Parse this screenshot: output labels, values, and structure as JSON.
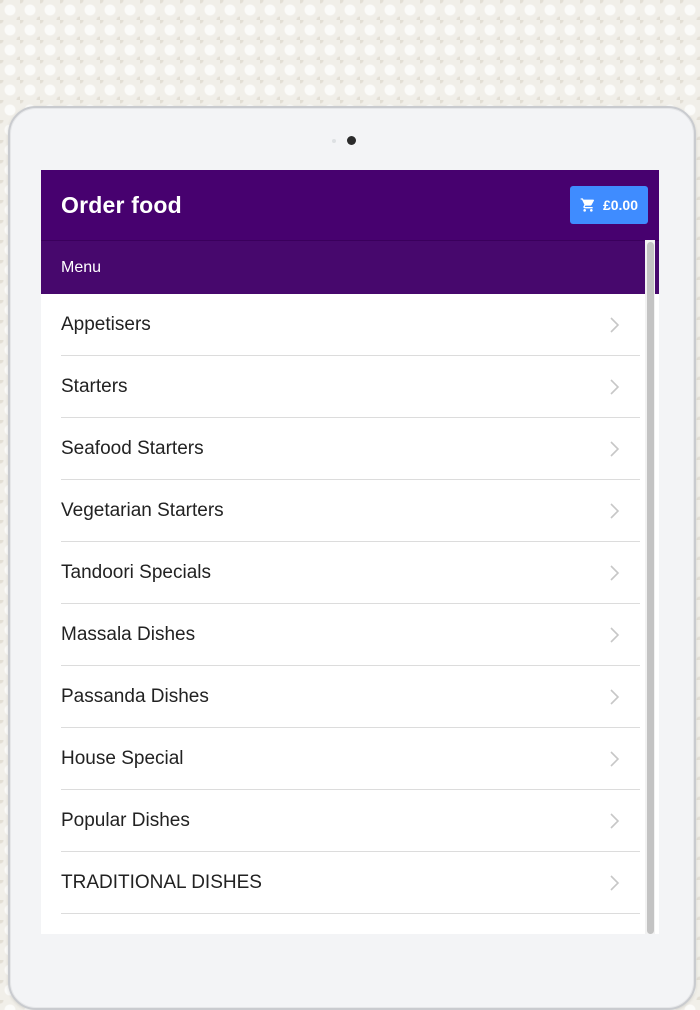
{
  "header": {
    "title": "Order food",
    "cart_total": "£0.00"
  },
  "subheader": {
    "label": "Menu"
  },
  "menu": {
    "items": [
      {
        "label": "Appetisers"
      },
      {
        "label": "Starters"
      },
      {
        "label": "Seafood Starters"
      },
      {
        "label": "Vegetarian Starters"
      },
      {
        "label": "Tandoori Specials"
      },
      {
        "label": "Massala Dishes"
      },
      {
        "label": "Passanda Dishes"
      },
      {
        "label": "House Special"
      },
      {
        "label": "Popular Dishes"
      },
      {
        "label": "TRADITIONAL DISHES"
      },
      {
        "label": ""
      }
    ]
  },
  "icons": {
    "cart": "cart-icon",
    "chevron": "chevron-right-icon"
  },
  "colors": {
    "appbar": "#47016f",
    "subheader": "#47086d",
    "cart_button": "#3f8cff",
    "chevron": "#c7c7c7"
  }
}
